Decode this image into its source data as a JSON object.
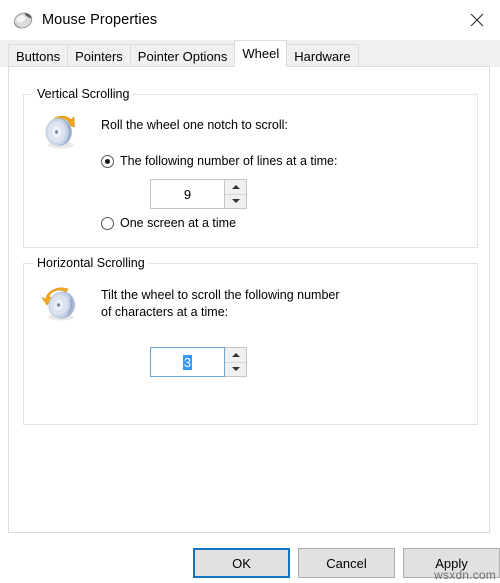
{
  "window": {
    "title": "Mouse Properties",
    "icon": "mouse-icon",
    "close_label": "✕"
  },
  "tabs": [
    {
      "label": "Buttons",
      "active": false
    },
    {
      "label": "Pointers",
      "active": false
    },
    {
      "label": "Pointer Options",
      "active": false
    },
    {
      "label": "Wheel",
      "active": true
    },
    {
      "label": "Hardware",
      "active": false
    }
  ],
  "vertical_group": {
    "title": "Vertical Scrolling",
    "icon": "scroll-wheel-vertical-icon",
    "description": "Roll the wheel one notch to scroll:",
    "radio_lines": {
      "label": "The following number of lines at a time:",
      "checked": true
    },
    "spinner": {
      "value": "9",
      "up": "spinner-up-arrow",
      "down": "spinner-down-arrow"
    },
    "radio_screen": {
      "label": "One screen at a time",
      "checked": false
    }
  },
  "horizontal_group": {
    "title": "Horizontal Scrolling",
    "icon": "scroll-wheel-horizontal-icon",
    "description_line1": "Tilt the wheel to scroll the following number",
    "description_line2": "of characters at a time:",
    "spinner": {
      "value": "3",
      "selected": true,
      "up": "spinner-up-arrow",
      "down": "spinner-down-arrow"
    }
  },
  "buttons": {
    "ok": "OK",
    "cancel": "Cancel",
    "apply": "Apply"
  },
  "watermark": "wsxdn.com",
  "colors": {
    "accent": "#1075c2",
    "selection": "#3399ff",
    "panel_border": "#dcdcdc",
    "group_border": "#e2e2e2",
    "button_face": "#e1e1e1",
    "tabstrip": "#f0f0f0"
  }
}
